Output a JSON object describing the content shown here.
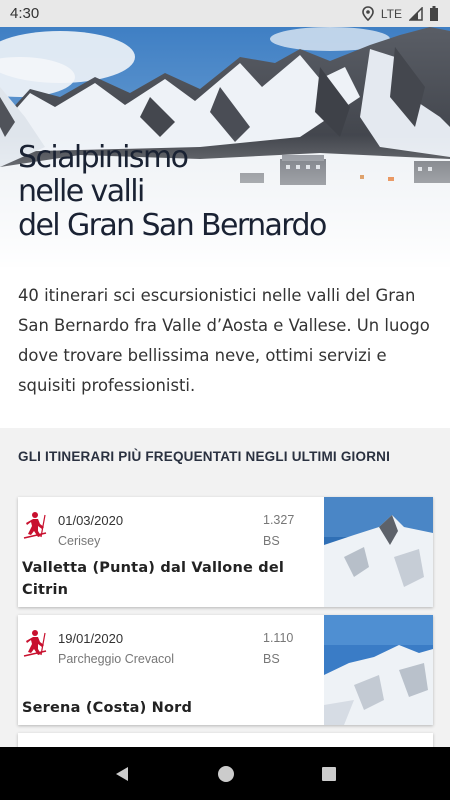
{
  "status_bar": {
    "time": "4:30",
    "network": "LTE",
    "icons": [
      "location-icon",
      "signal-icon",
      "battery-icon"
    ]
  },
  "hero": {
    "title_lines": [
      "Scialpinismo",
      "nelle valli",
      "del Gran San Bernardo"
    ]
  },
  "intro": {
    "text": "40 itinerari sci escursionistici nelle valli del Gran San Bernardo fra Valle d’Aosta e Vallese. Un luogo dove trovare bellissima neve, ottimi servizi e squisiti professionisti."
  },
  "section": {
    "title": "GLI ITINERARI PIÙ FREQUENTATI NEGLI ULTIMI GIORNI"
  },
  "itineraries": [
    {
      "date": "01/03/2020",
      "start_point": "Cerisey",
      "altitude": "1.327",
      "grade": "BS",
      "name": "Valletta (Punta) dal Vallone del Citrin",
      "icon": "ski-touring-icon"
    },
    {
      "date": "19/01/2020",
      "start_point": "Parcheggio Crevacol",
      "altitude": "1.110",
      "grade": "BS",
      "name": "Serena (Costa) Nord",
      "icon": "ski-touring-icon"
    }
  ],
  "nav_bar": {
    "buttons": [
      "back-icon",
      "home-icon",
      "recents-icon"
    ]
  },
  "colors": {
    "accent": "#c8102e",
    "title": "#1a2233"
  }
}
